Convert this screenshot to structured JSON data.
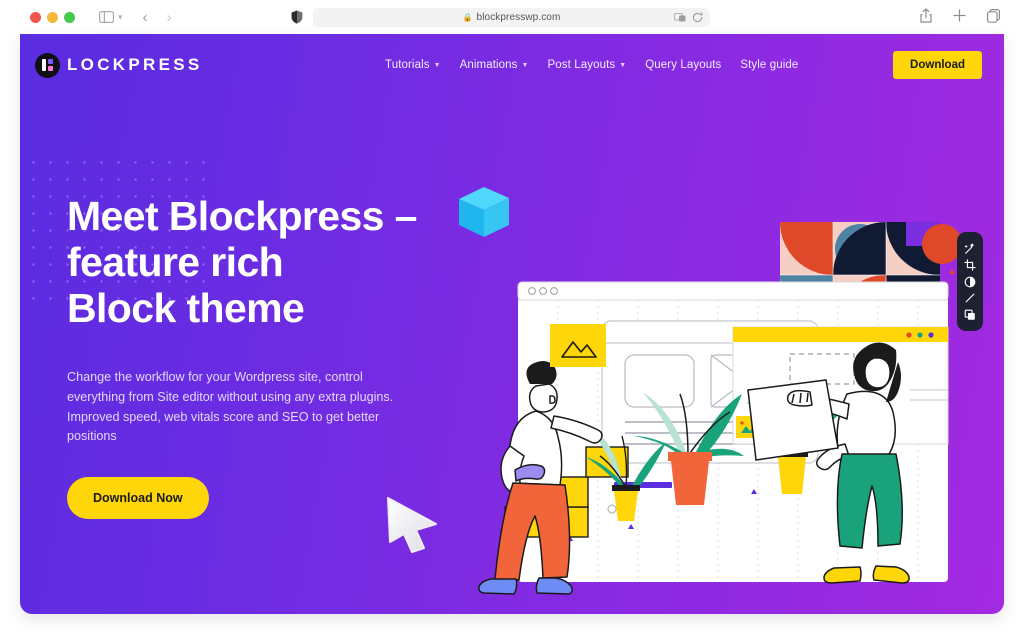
{
  "browser": {
    "url": "blockpresswp.com",
    "lock_icon": "lock-icon",
    "shield_icon": "privacy-shield-icon",
    "sidebar_icon": "sidebar-toggle-icon",
    "back_icon": "back-arrow-icon",
    "forward_icon": "forward-arrow-icon",
    "reload_icon": "reload-icon",
    "extension_icon": "extensions-icon",
    "share_icon": "share-icon",
    "new_tab_icon": "new-tab-icon",
    "tab_overview_icon": "tab-overview-icon",
    "traffic_lights": [
      "close",
      "minimize",
      "zoom"
    ]
  },
  "site": {
    "brand_name": "LOCKPRESS",
    "brand_mark_icon": "blockpress-logo-icon",
    "nav": [
      {
        "label": "Tutorials",
        "has_dropdown": true
      },
      {
        "label": "Animations",
        "has_dropdown": true
      },
      {
        "label": "Post Layouts",
        "has_dropdown": true
      },
      {
        "label": "Query Layouts",
        "has_dropdown": false
      },
      {
        "label": "Style guide",
        "has_dropdown": false
      }
    ],
    "header_cta": "Download"
  },
  "hero": {
    "title_line_1": "Meet Blockpress –",
    "title_line_2": "feature rich",
    "title_line_3": "Block theme",
    "subtitle": "Change the workflow for your Wordpress site, control everything from Site editor without using any extra plugins. Improved speed, web vitals score and SEO to get better positions",
    "cta": "Download Now"
  },
  "illustration": {
    "cube_icon": "3d-cube-icon",
    "cursor_icon": "3d-cursor-icon",
    "plants": [
      "potted-plant-yellow",
      "potted-plant-orange",
      "potted-plant-yellow"
    ],
    "characters": [
      "person-placing-image-block",
      "person-carrying-panel"
    ],
    "toolbar_tools": [
      "magic-wand-icon",
      "crop-icon",
      "contrast-icon",
      "pen-line-icon",
      "layers-icon"
    ]
  },
  "colors": {
    "gradient_start": "#5a2ce0",
    "gradient_end": "#a32ae0",
    "accent_yellow": "#ffd60a",
    "text_white": "#ffffff",
    "subtitle": "#e4d8fb",
    "toolbar_dark": "#1d2030",
    "cube_cyan": "#35c6f4",
    "orange": "#f2653b",
    "teal": "#1aa37a"
  }
}
